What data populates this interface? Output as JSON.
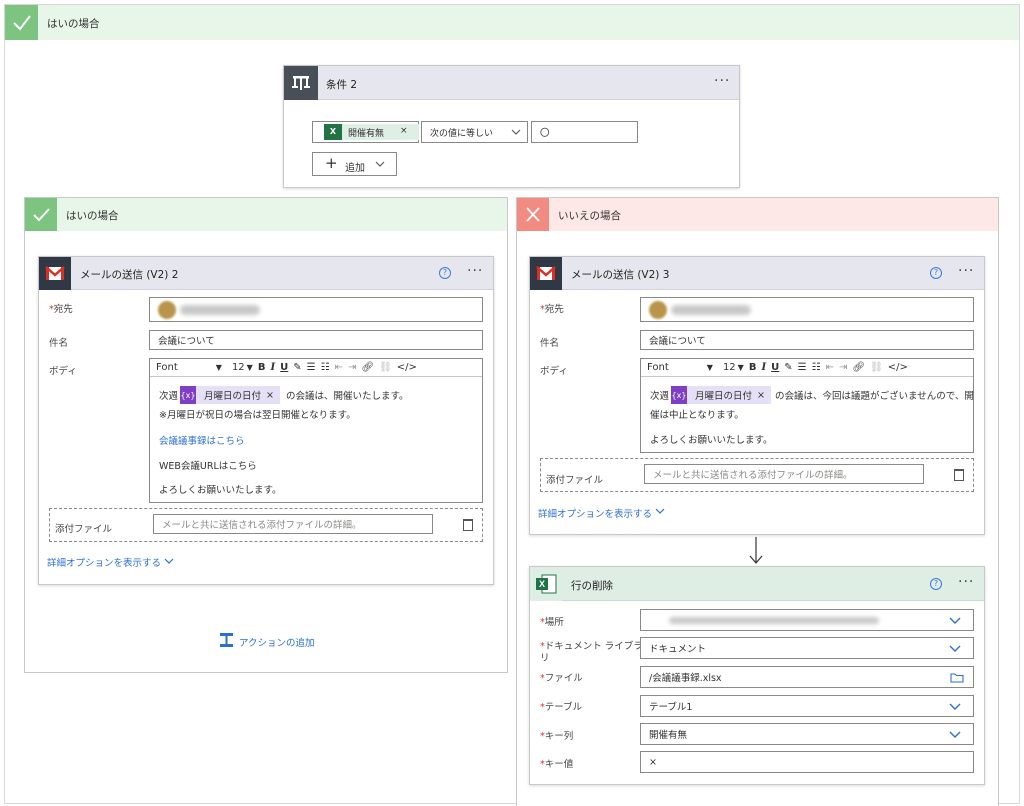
{
  "top_branch": {
    "label": "はいの場合"
  },
  "condition": {
    "title": "条件 2",
    "more": "···",
    "token_label": "開催有無",
    "token_remove": "×",
    "operator": "次の値に等しい",
    "value": "〇",
    "add_label": "追加"
  },
  "yes_branch": {
    "label": "はいの場合",
    "card": {
      "title": "メールの送信 (V2) 2",
      "help": "?",
      "more": "···",
      "to_label": "宛先",
      "subject_label": "件名",
      "subject_value": "会議について",
      "body_label": "ボディ",
      "font": "Font",
      "font_size": "12",
      "body_prefix": "次週",
      "token_label": "月曜日の日付",
      "token_remove": "×",
      "body_suffix": "の会議は、開催いたします。",
      "body_note": "※月曜日が祝日の場合は翌日開催となります。",
      "minutes_link": "会議議事録はこちら",
      "web_url": "WEB会議URLはこちら",
      "closing": "よろしくお願いいたします。",
      "attach_label": "添付ファイル",
      "attach_placeholder": "メールと共に送信される添付ファイルの詳細。",
      "advanced": "詳細オプションを表示する"
    },
    "add_action": "アクションの追加"
  },
  "no_branch": {
    "label": "いいえの場合",
    "card": {
      "title": "メールの送信 (V2) 3",
      "help": "?",
      "more": "···",
      "to_label": "宛先",
      "subject_label": "件名",
      "subject_value": "会議について",
      "body_label": "ボディ",
      "font": "Font",
      "font_size": "12",
      "body_prefix": "次週",
      "token_label": "月曜日の日付",
      "token_remove": "×",
      "body_suffix": "の会議は、今回は議題がございませんので、開",
      "body_line2": "催は中止となります。",
      "closing": "よろしくお願いいたします。",
      "attach_label": "添付ファイル",
      "attach_placeholder": "メールと共に送信される添付ファイルの詳細。",
      "advanced": "詳細オプションを表示する"
    },
    "excel": {
      "title": "行の削除",
      "help": "?",
      "more": "···",
      "location_label": "場所",
      "library_label_1": "ドキュメント ライブラ",
      "library_label_2": "リ",
      "library_value": "ドキュメント",
      "file_label": "ファイル",
      "file_value": "/会議議事録.xlsx",
      "table_label": "テーブル",
      "table_value": "テーブル1",
      "keycol_label": "キー列",
      "keycol_value": "開催有無",
      "keyval_label": "キー値",
      "keyval_value": "×"
    }
  },
  "colors": {
    "accent": "#2b6fd1",
    "yes": "#7cc47f",
    "no": "#f28b82",
    "token": "#7e3fc4",
    "gmail": "#d93025",
    "excel": "#217346"
  }
}
